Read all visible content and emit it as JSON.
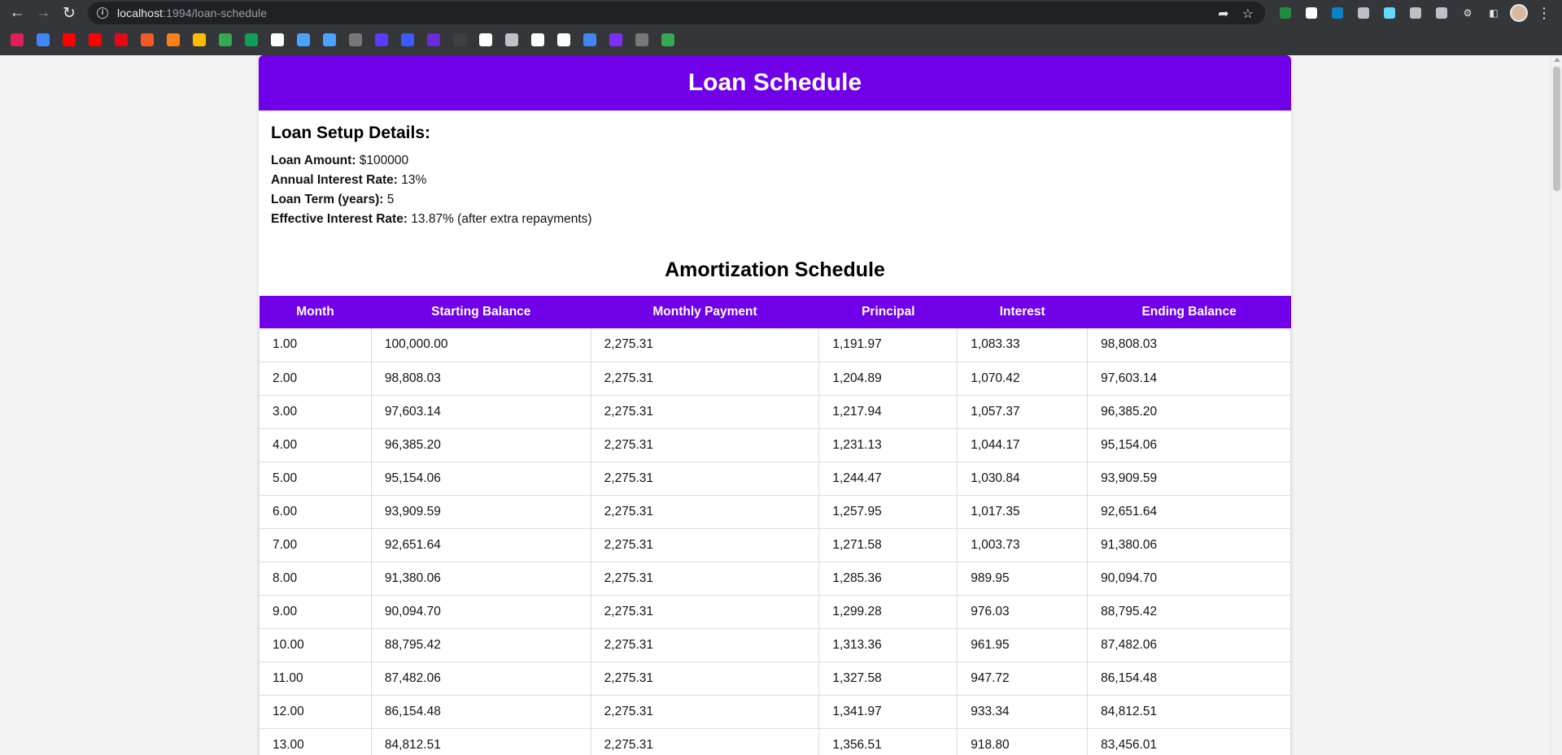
{
  "browser": {
    "url_host": "localhost",
    "url_path": ":1994/loan-schedule",
    "bookmarks": [
      {
        "name": "slack-bookmark-icon",
        "color": "#e01e5a"
      },
      {
        "name": "multicolor-bookmark-icon",
        "color": "#4285f4"
      },
      {
        "name": "youtube-bookmark-icon",
        "color": "#ff0000"
      },
      {
        "name": "youtube-music-bookmark-icon",
        "color": "#ff0000"
      },
      {
        "name": "netflix-bookmark-icon",
        "color": "#e50914"
      },
      {
        "name": "red-shield-bookmark-icon",
        "color": "#f15a24"
      },
      {
        "name": "swiggy-bookmark-icon",
        "color": "#fc8019"
      },
      {
        "name": "keep-bookmark-icon",
        "color": "#fbbc04"
      },
      {
        "name": "running-man-bookmark-icon",
        "color": "#34a853"
      },
      {
        "name": "sheets-bookmark-icon",
        "color": "#0f9d58"
      },
      {
        "name": "amazon-bookmark-icon",
        "color": "#ffffff"
      },
      {
        "name": "crescent-bookmark-icon",
        "color": "#4aa3ff"
      },
      {
        "name": "y-bookmark-icon",
        "color": "#4aa3ff"
      },
      {
        "name": "grey-gear-bookmark-icon",
        "color": "#777777"
      },
      {
        "name": "purple-square-bookmark-icon",
        "color": "#5b3bff"
      },
      {
        "name": "blue-diamond-bookmark-icon",
        "color": "#3b5bff"
      },
      {
        "name": "purple-circle-bookmark-icon",
        "color": "#6a2bd9"
      },
      {
        "name": "dark-bookmark-icon",
        "color": "#3c4043"
      },
      {
        "name": "medium-bookmark-icon",
        "color": "#ffffff"
      },
      {
        "name": "percent-bookmark-icon",
        "color": "#bdc1c6"
      },
      {
        "name": "notion-bookmark-icon",
        "color": "#ffffff"
      },
      {
        "name": "globe-bookmark-icon",
        "color": "#ffffff"
      },
      {
        "name": "calendar-bookmark-icon",
        "color": "#4285f4"
      },
      {
        "name": "purple-pill-bookmark-icon",
        "color": "#7b2ff7"
      },
      {
        "name": "grey-gear2-bookmark-icon",
        "color": "#777777"
      },
      {
        "name": "drive-bookmark-icon",
        "color": "#34a853"
      }
    ],
    "extensions": [
      {
        "name": "green-ext-icon",
        "color": "#1e8e3e"
      },
      {
        "name": "w-ext-icon",
        "color": "#ffffff"
      },
      {
        "name": "blue-b-ext-icon",
        "color": "#0a84c4"
      },
      {
        "name": "mouse-ext-icon",
        "color": "#bdc1c6"
      },
      {
        "name": "react-ext-icon",
        "color": "#61dafb"
      },
      {
        "name": "vue-ext-icon",
        "color": "#bdc1c6"
      },
      {
        "name": "vuex-ext-icon",
        "color": "#bdc1c6"
      }
    ]
  },
  "page": {
    "title": "Loan Schedule",
    "setup": {
      "heading": "Loan Setup Details:",
      "fields": [
        {
          "label": "Loan Amount:",
          "value": " $100000"
        },
        {
          "label": "Annual Interest Rate:",
          "value": " 13%"
        },
        {
          "label": "Loan Term (years):",
          "value": " 5"
        },
        {
          "label": "Effective Interest Rate:",
          "value": " 13.87% (after extra repayments)"
        }
      ]
    },
    "amortization_title": "Amortization Schedule",
    "table": {
      "headers": [
        "Month",
        "Starting Balance",
        "Monthly Payment",
        "Principal",
        "Interest",
        "Ending Balance"
      ],
      "rows": [
        [
          "1.00",
          "100,000.00",
          "2,275.31",
          "1,191.97",
          "1,083.33",
          "98,808.03"
        ],
        [
          "2.00",
          "98,808.03",
          "2,275.31",
          "1,204.89",
          "1,070.42",
          "97,603.14"
        ],
        [
          "3.00",
          "97,603.14",
          "2,275.31",
          "1,217.94",
          "1,057.37",
          "96,385.20"
        ],
        [
          "4.00",
          "96,385.20",
          "2,275.31",
          "1,231.13",
          "1,044.17",
          "95,154.06"
        ],
        [
          "5.00",
          "95,154.06",
          "2,275.31",
          "1,244.47",
          "1,030.84",
          "93,909.59"
        ],
        [
          "6.00",
          "93,909.59",
          "2,275.31",
          "1,257.95",
          "1,017.35",
          "92,651.64"
        ],
        [
          "7.00",
          "92,651.64",
          "2,275.31",
          "1,271.58",
          "1,003.73",
          "91,380.06"
        ],
        [
          "8.00",
          "91,380.06",
          "2,275.31",
          "1,285.36",
          "989.95",
          "90,094.70"
        ],
        [
          "9.00",
          "90,094.70",
          "2,275.31",
          "1,299.28",
          "976.03",
          "88,795.42"
        ],
        [
          "10.00",
          "88,795.42",
          "2,275.31",
          "1,313.36",
          "961.95",
          "87,482.06"
        ],
        [
          "11.00",
          "87,482.06",
          "2,275.31",
          "1,327.58",
          "947.72",
          "86,154.48"
        ],
        [
          "12.00",
          "86,154.48",
          "2,275.31",
          "1,341.97",
          "933.34",
          "84,812.51"
        ],
        [
          "13.00",
          "84,812.51",
          "2,275.31",
          "1,356.51",
          "918.80",
          "83,456.01"
        ]
      ]
    }
  }
}
